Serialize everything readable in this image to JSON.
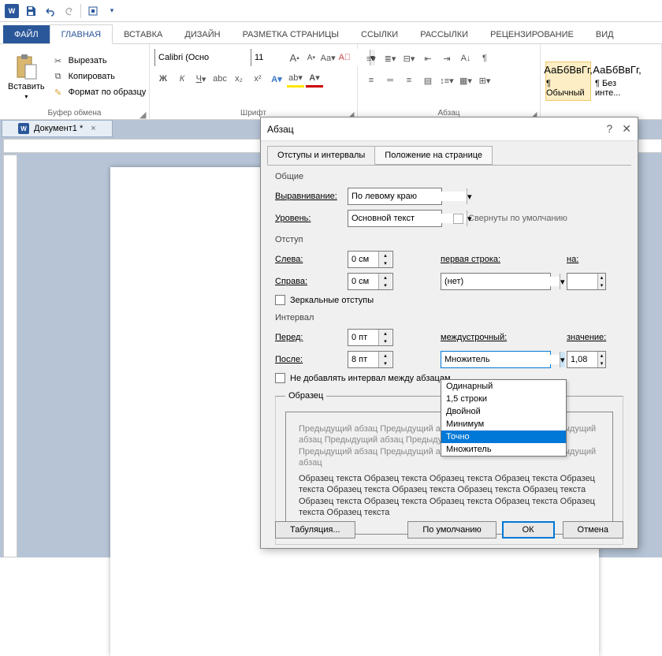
{
  "qat": {
    "app": "W"
  },
  "tabs": {
    "file": "ФАЙЛ",
    "home": "ГЛАВНАЯ",
    "insert": "ВСТАВКА",
    "design": "ДИЗАЙН",
    "layout": "РАЗМЕТКА СТРАНИЦЫ",
    "refs": "ССЫЛКИ",
    "mail": "РАССЫЛКИ",
    "review": "РЕЦЕНЗИРОВАНИЕ",
    "view": "ВИД"
  },
  "clipboard": {
    "paste": "Вставить",
    "cut": "Вырезать",
    "copy": "Копировать",
    "fmt": "Формат по образцу",
    "title": "Буфер обмена"
  },
  "font": {
    "name": "Calibri (Осно",
    "size": "11",
    "title": "Шрифт"
  },
  "para": {
    "title": "Абзац"
  },
  "styles": {
    "s1": "АаБбВвГг,",
    "s1n": "¶ Обычный",
    "s2": "АаБбВвГг,",
    "s2n": "¶ Без инте..."
  },
  "doc": {
    "name": "Документ1 *"
  },
  "dialog": {
    "title": "Абзац",
    "tab1": "Отступы и интервалы",
    "tab2": "Положение на странице",
    "general": "Общие",
    "align_l": "Выравнивание:",
    "align_v": "По левому краю",
    "level_l": "Уровень:",
    "level_v": "Основной текст",
    "collapse": "Свернуты по умолчанию",
    "indent": "Отступ",
    "left_l": "Слева:",
    "left_v": "0 см",
    "right_l": "Справа:",
    "right_v": "0 см",
    "first_l": "первая строка:",
    "first_v": "(нет)",
    "by_l": "на:",
    "mirror": "Зеркальные отступы",
    "spacing": "Интервал",
    "before_l": "Перед:",
    "before_v": "0 пт",
    "after_l": "После:",
    "after_v": "8 пт",
    "line_l": "междустрочный:",
    "line_v": "Множитель",
    "value_l": "значение:",
    "value_v": "1,08",
    "noadd": "Не добавлять интервал между абзацам",
    "sample": "Образец",
    "prev_grey": "Предыдущий абзац Предыдущий абзац Предыдущий абзац Предыдущий абзац Предыдущий абзац Предыдущий абзац Предыдущий абзац Предыдущий абзац Предыдущий абзац Предыдущий абзац Предыдущий абзац",
    "prev_dark": "Образец текста Образец текста Образец текста Образец текста Образец текста Образец текста Образец текста Образец текста Образец текста Образец текста Образец текста Образец текста Образец текста Образец текста Образец текста",
    "tabs_btn": "Табуляция...",
    "default_btn": "По умолчанию",
    "ok": "ОК",
    "cancel": "Отмена",
    "dd": [
      "Одинарный",
      "1,5 строки",
      "Двойной",
      "Минимум",
      "Точно",
      "Множитель"
    ]
  }
}
